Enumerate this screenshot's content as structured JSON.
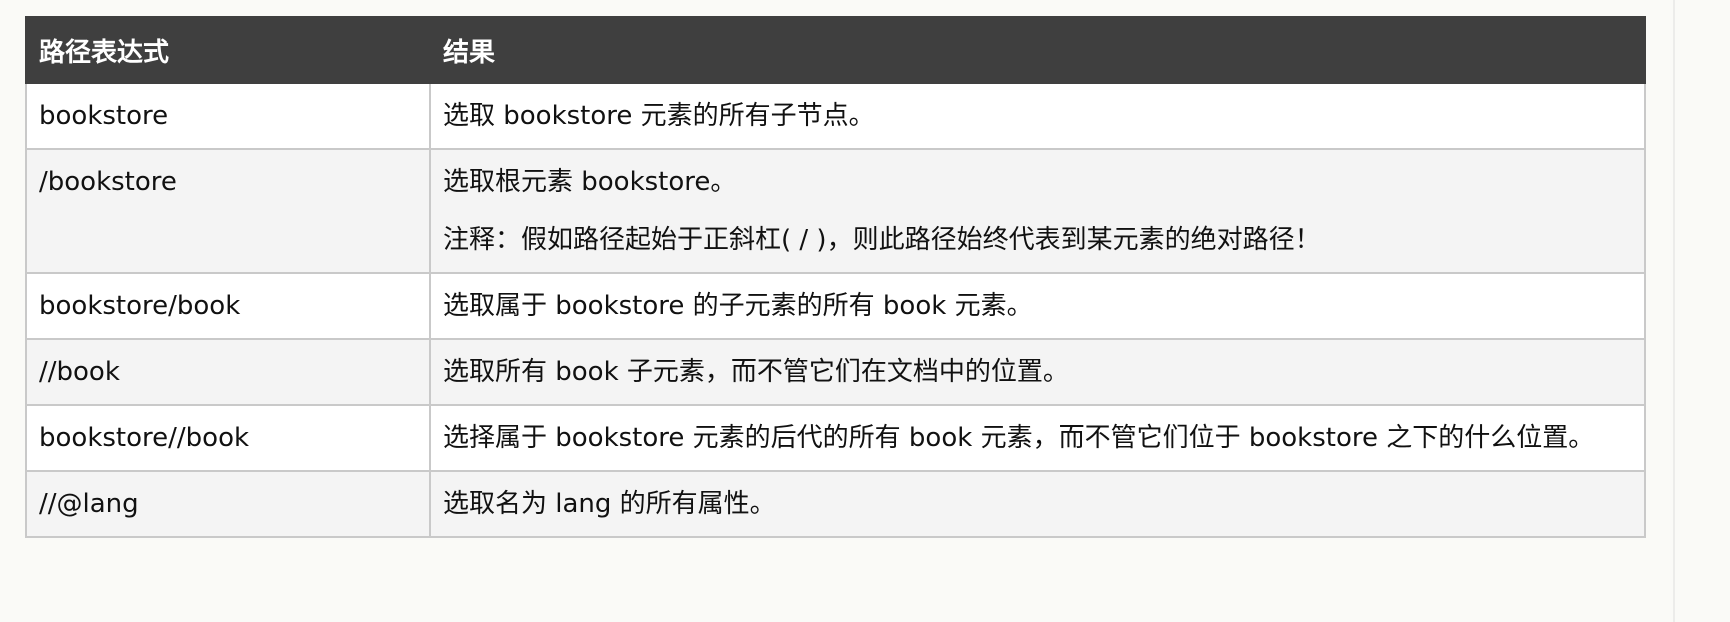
{
  "table": {
    "headers": [
      "路径表达式",
      "结果"
    ],
    "rows": [
      {
        "expression": "bookstore",
        "result": "选取 bookstore 元素的所有子节点。",
        "note": ""
      },
      {
        "expression": "/bookstore",
        "result": "选取根元素 bookstore。",
        "note": "注释：假如路径起始于正斜杠( / )，则此路径始终代表到某元素的绝对路径！"
      },
      {
        "expression": "bookstore/book",
        "result": "选取属于 bookstore 的子元素的所有 book 元素。",
        "note": ""
      },
      {
        "expression": "//book",
        "result": "选取所有 book 子元素，而不管它们在文档中的位置。",
        "note": ""
      },
      {
        "expression": "bookstore//book",
        "result": "选择属于 bookstore 元素的后代的所有 book 元素，而不管它们位于 bookstore 之下的什么位置。",
        "note": ""
      },
      {
        "expression": "//@lang",
        "result": "选取名为 lang 的所有属性。",
        "note": ""
      }
    ]
  }
}
